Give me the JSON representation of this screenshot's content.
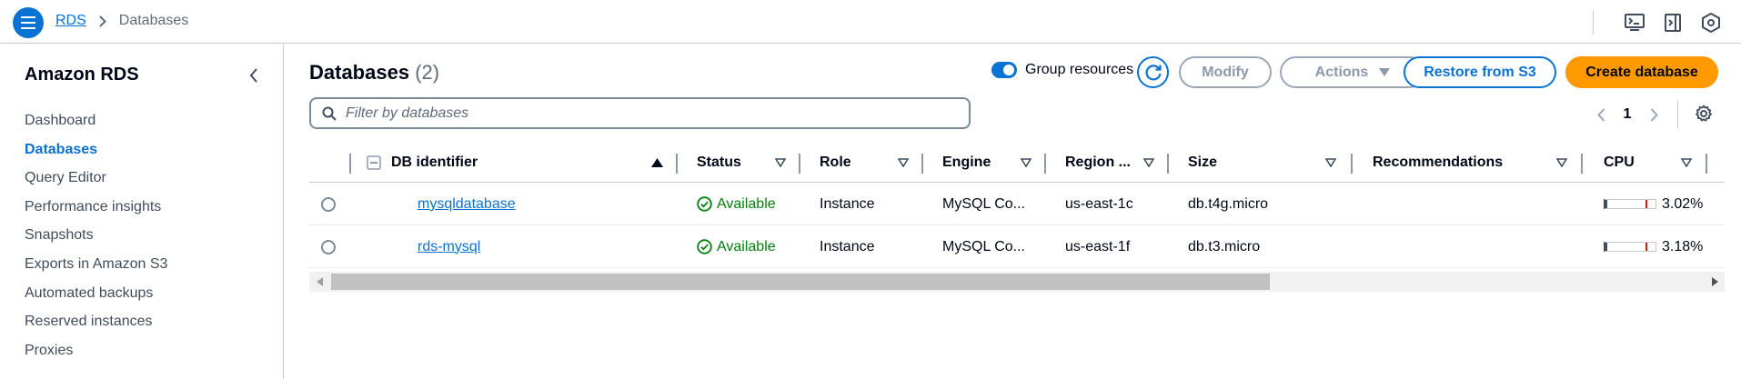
{
  "topbar": {
    "menu_icon": "hamburger-menu-icon",
    "breadcrumb": {
      "root": "RDS",
      "current": "Databases"
    },
    "icons": [
      "cloudshell-icon",
      "notifications-panel-icon",
      "settings-hexagon-icon"
    ]
  },
  "sidebar": {
    "title": "Amazon RDS",
    "items": [
      {
        "label": "Dashboard",
        "active": false
      },
      {
        "label": "Databases",
        "active": true
      },
      {
        "label": "Query Editor",
        "active": false
      },
      {
        "label": "Performance insights",
        "active": false
      },
      {
        "label": "Snapshots",
        "active": false
      },
      {
        "label": "Exports in Amazon S3",
        "active": false
      },
      {
        "label": "Automated backups",
        "active": false
      },
      {
        "label": "Reserved instances",
        "active": false
      },
      {
        "label": "Proxies",
        "active": false
      }
    ]
  },
  "main": {
    "title": "Databases",
    "count": "(2)",
    "group_resources_label": "Group resources",
    "group_resources_on": true,
    "buttons": {
      "modify": "Modify",
      "actions": "Actions",
      "restore": "Restore from S3",
      "create": "Create database"
    },
    "filter_placeholder": "Filter by databases",
    "pagination": {
      "current_page": "1"
    }
  },
  "table": {
    "columns": [
      "DB identifier",
      "Status",
      "Role",
      "Engine",
      "Region ...",
      "Size",
      "Recommendations",
      "CPU"
    ],
    "rows": [
      {
        "id": "mysqldatabase",
        "status": "Available",
        "role": "Instance",
        "engine": "MySQL Co...",
        "region": "us-east-1c",
        "size": "db.t4g.micro",
        "recommendations": "",
        "cpu": "3.02%",
        "cpu_value": 3.02
      },
      {
        "id": "rds-mysql",
        "status": "Available",
        "role": "Instance",
        "engine": "MySQL Co...",
        "region": "us-east-1f",
        "size": "db.t3.micro",
        "recommendations": "",
        "cpu": "3.18%",
        "cpu_value": 3.18
      }
    ]
  },
  "colors": {
    "accent": "#0972d3",
    "primary_button": "#ff9900",
    "status_available": "#037f0c",
    "disabled": "#8d99a8"
  }
}
